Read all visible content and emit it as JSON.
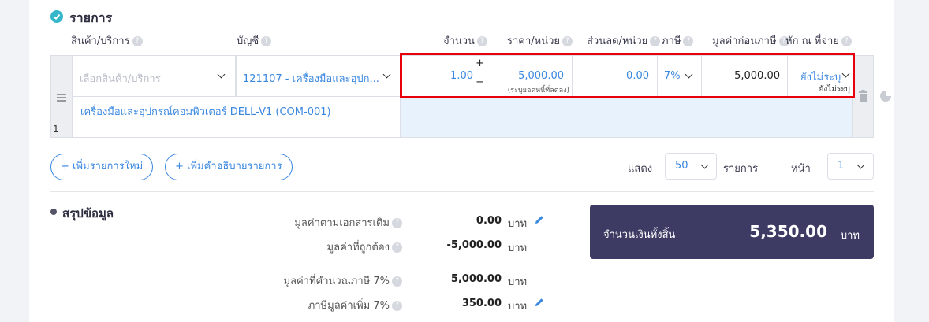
{
  "section": {
    "title": "รายการ"
  },
  "columns": {
    "product": "สินค้า/บริการ",
    "account": "บัญชี",
    "qty": "จำนวน",
    "price": "ราคา/หน่วย",
    "discount": "ส่วนลด/หน่วย",
    "vat": "ภาษี",
    "pretax": "มูลค่าก่อนภาษี",
    "wht": "หัก ณ ที่จ่าย"
  },
  "row": {
    "index": "1",
    "product_placeholder": "เลือกสินค้า/บริการ",
    "account_value": "121107 - เครื่องมือและอุปก...",
    "description": "เครื่องมือและอุปกรณ์คอมพิวเตอร์ DELL-V1 (COM-001)",
    "qty": "1.00",
    "qty_plus": "+",
    "qty_minus": "−",
    "price": "5,000.00",
    "price_note": "(ระบุยอดหนี้ที่ลดลง)",
    "discount": "0.00",
    "vat": "7%",
    "pretax": "5,000.00",
    "wht": "ยังไม่ระบุ",
    "wht_sub": "ยังไม่ระบุ"
  },
  "actions": {
    "add_item": "+ เพิ่มรายการใหม่",
    "add_desc": "+ เพิ่มคำอธิบายรายการ"
  },
  "pagination": {
    "show_label": "แสดง",
    "page_size": "50",
    "items_label": "รายการ",
    "page_label": "หน้า",
    "page": "1"
  },
  "summary": {
    "title": "สรุปข้อมูล",
    "rows": [
      {
        "label": "มูลค่าตามเอกสารเดิม",
        "value": "0.00",
        "unit": "บาท"
      },
      {
        "label": "มูลค่าที่ถูกต้อง",
        "value": "-5,000.00",
        "unit": "บาท"
      },
      {
        "label": "มูลค่าที่คำนวณภาษี 7%",
        "value": "5,000.00",
        "unit": "บาท"
      },
      {
        "label": "ภาษีมูลค่าเพิ่ม 7%",
        "value": "350.00",
        "unit": "บาท"
      }
    ],
    "total_label": "จำนวนเงินทั้งสิ้น",
    "total_value": "5,350.00",
    "total_unit": "บาท"
  },
  "colors": {
    "accent": "#3a87e0",
    "highlight": "#e8f2fd",
    "total_bg": "#3d3b63",
    "check": "#35b6c9",
    "red_outline": "#e8000b"
  },
  "icons": [
    "check-circle-icon",
    "help-icon",
    "chevron-down-icon",
    "drag-handle-icon",
    "trash-icon",
    "pie-icon",
    "pencil-icon",
    "bullet-icon"
  ]
}
